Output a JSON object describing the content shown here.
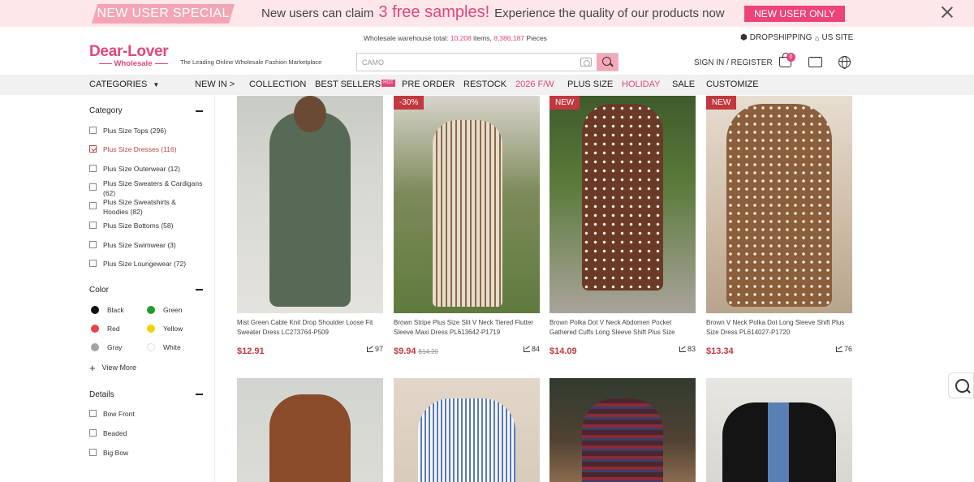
{
  "promo": {
    "tag": "NEW USER SPECIAL",
    "text_before": "New users can claim",
    "highlight": "3 free samples!",
    "text_after": "Experience the quality of our products now",
    "button": "NEW USER ONLY"
  },
  "header": {
    "warehouse_prefix": "Wholesale warehouse total:",
    "warehouse_items": "10,208",
    "items_word": "items,",
    "warehouse_pieces": "8,386,187",
    "pieces_word": "Pieces",
    "dropshipping": "DROPSHIPPING",
    "site": "US SITE",
    "logo_main": "Dear-Lover",
    "logo_sub": "Wholesale",
    "tagline": "The Leading Online Wholesale Fashion Marketplace",
    "search_placeholder": "CAMO",
    "signin": "SIGN IN / REGISTER",
    "cart_count": "0"
  },
  "nav": {
    "categories": "CATEGORIES",
    "items": [
      "NEW IN >",
      "COLLECTION",
      "BEST SELLERS",
      "PRE ORDER",
      "RESTOCK",
      "2026 F/W",
      "PLUS SIZE",
      "HOLIDAY",
      "SALE",
      "CUSTOMIZE"
    ],
    "hot": "HOT"
  },
  "sidebar": {
    "category_title": "Category",
    "categories": [
      "Plus Size Tops (296)",
      "Plus Size Dresses (116)",
      "Plus Size Outerwear (12)",
      "Plus Size Sweaters & Cardigans (62)",
      "Plus Size Sweatshirts & Hoodies (82)",
      "Plus Size Bottoms (58)",
      "Plus Size Swimwear (3)",
      "Plus Size Loungewear (72)"
    ],
    "color_title": "Color",
    "colors": [
      {
        "name": "Black",
        "hex": "#111111"
      },
      {
        "name": "Green",
        "hex": "#1e9e2e"
      },
      {
        "name": "Red",
        "hex": "#e84545"
      },
      {
        "name": "Yellow",
        "hex": "#f3d200"
      },
      {
        "name": "Gray",
        "hex": "#a3a3a3"
      },
      {
        "name": "White",
        "hex": "#ffffff"
      }
    ],
    "view_more": "View More",
    "details_title": "Details",
    "details": [
      "Bow Front",
      "Beaded",
      "Big Bow"
    ]
  },
  "products": [
    {
      "name": "Mist Green Cable Knit Drop Shoulder Loose Fit Sweater Dress LC273764-P509",
      "price": "$12.91",
      "old_price": "",
      "sold": "97",
      "badge": ""
    },
    {
      "name": "Brown Stripe Plus Size Slit V Neck Tiered Flutter Sleeve Maxi Dress PL613642-P1719",
      "price": "$9.94",
      "old_price": "$14.20",
      "sold": "84",
      "badge": "-30%"
    },
    {
      "name": "Brown Polka Dot V Neck Abdomen Pocket Gathered Cuffs Long Sleeve Shift Plus Size Dres...",
      "price": "$14.09",
      "old_price": "",
      "sold": "83",
      "badge": "NEW"
    },
    {
      "name": "Brown V Neck Polka Dot Long Sleeve Shift Plus Size Dress PL614027-P1720",
      "price": "$13.34",
      "old_price": "",
      "sold": "76",
      "badge": "NEW"
    }
  ],
  "colors": {
    "accent": "#e2467a",
    "price": "#c2383f",
    "promo_bg": "#fde7ea"
  }
}
